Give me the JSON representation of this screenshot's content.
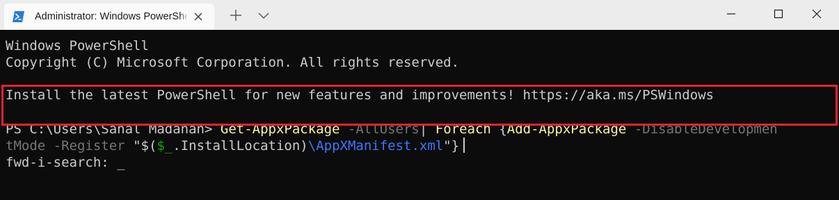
{
  "window": {
    "tab_title": "Administrator: Windows PowerShell",
    "icons": {
      "tab_icon": "powershell-icon",
      "tab_close": "close-icon",
      "new_tab": "plus-icon",
      "dropdown": "chevron-down-icon",
      "minimize": "minimize-icon",
      "maximize": "maximize-icon",
      "close": "close-icon"
    }
  },
  "terminal": {
    "banner_line1": "Windows PowerShell",
    "banner_line2": "Copyright (C) Microsoft Corporation. All rights reserved.",
    "install_notice": "Install the latest PowerShell for new features and improvements! https://aka.ms/PSWindows",
    "prompt": "PS C:\\Users\\Sanal Madanan>",
    "command": {
      "cmdlet1": "Get-AppxPackage",
      "param1": "-AllUsers",
      "pipe": "|",
      "foreach": "Foreach",
      "brace_open": "{",
      "cmdlet2": "Add-AppxPackage",
      "param2_part1": "-DisableDevelopmen",
      "param2_part2": "tMode",
      "param3": "-Register",
      "string_open": "\"$(",
      "variable": "$_",
      "property": ".InstallLocation)",
      "manifest": "\\AppXManifest.xml",
      "string_close": "\"",
      "brace_close": "}"
    },
    "search_line": "fwd-i-search: _"
  },
  "colors": {
    "background": "#0c0c0c",
    "foreground": "#cccccc",
    "cmdlet_yellow": "#f9f1a5",
    "parameter_gray": "#767676",
    "variable_green": "#13a10e",
    "highlight_red": "#e8232f"
  }
}
